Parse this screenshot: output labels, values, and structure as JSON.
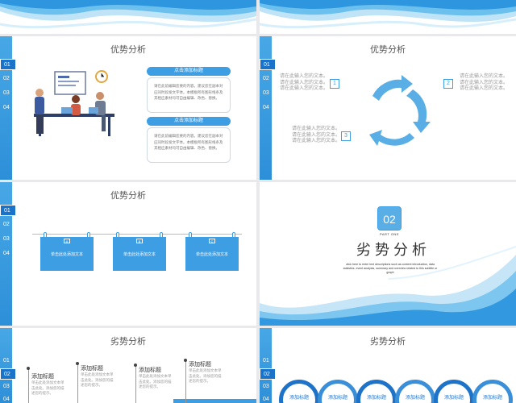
{
  "colors": {
    "accent": "#3d9ee4",
    "dark_accent": "#1e73c9",
    "sidebar": "#2d8fd8"
  },
  "nav_items": [
    "01",
    "02",
    "03",
    "04"
  ],
  "slide3": {
    "title": "优势分析",
    "box1_header": "点击添加标题",
    "box1_text": "请在此前编辑您要的内容。建议您在副本对应同时段发文字体。本模板所有图形线条及其相应素材均可自由编辑、改色、替换。",
    "box2_header": "点击添加标题",
    "box2_text": "请在此前编辑您要的内容。建议您在副本对应同时段发文字体。本模板所有图形线条及其相应素材均可自由编辑、改色、替换。",
    "illustration": "office-meeting-illustration"
  },
  "slide4": {
    "title": "优势分析",
    "left_text_1": "请在此输入您的文本。\n请在此输入您的文本。\n请在此输入您的文本。",
    "right_text": "请在此输入您的文本。\n请在此输入您的文本。\n请在此输入您的文本。",
    "left_text_2": "请在此输入您的文本。\n请在此输入您的文本。\n请在此输入您的文本。",
    "num1": "1",
    "num2": "2",
    "num3": "3"
  },
  "slide5": {
    "title": "优势分析",
    "cards": [
      {
        "tag": "A",
        "text": "单击此处添加文本"
      },
      {
        "tag": "B",
        "text": "单击此处添加文本"
      },
      {
        "tag": "C",
        "text": "单击此处添加文本"
      }
    ]
  },
  "slide6": {
    "badge": "02",
    "part": "PART ONE",
    "title": "劣势分析",
    "desc": "click here to enter text descriptions such as content introduction, data statistics, event analysis, summary and overview related to this subtitle or graph"
  },
  "slide7": {
    "title": "劣势分析",
    "items": [
      {
        "title": "添加标题",
        "desc": "单击此处添加文本单击此处。添加您的描述您的提示。"
      },
      {
        "title": "添加标题",
        "desc": "单击此处添加文本单击此处。添加您的描述您的提示。"
      },
      {
        "title": "添加标题",
        "desc": "单击此处添加文本单击此处。添加您的描述您的提示。"
      },
      {
        "title": "添加标题",
        "desc": "单击此处添加文本单击此处。添加您的描述您的提示。"
      }
    ]
  },
  "slide8": {
    "title": "劣势分析",
    "circles": [
      "添加标题",
      "添加标题",
      "添加标题",
      "添加标题",
      "添加标题",
      "添加标题"
    ]
  }
}
